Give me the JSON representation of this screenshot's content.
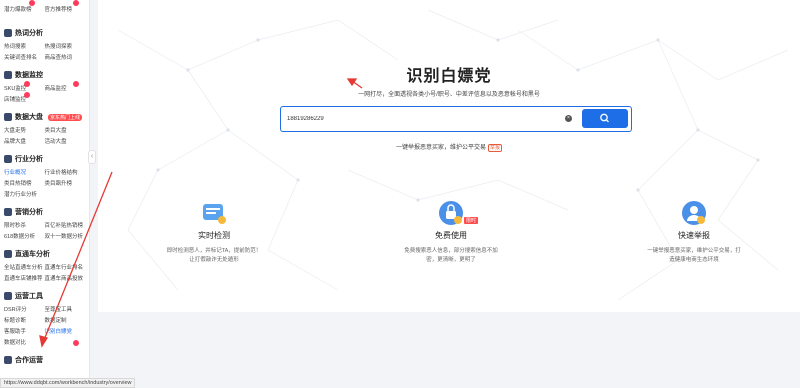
{
  "sidebar": {
    "top_row": [
      "潜力爆款榜",
      "官方推荐榜"
    ],
    "sections": [
      {
        "title": "热词分析",
        "tag": "",
        "items": [
          "热词搜索",
          "热搜词探索",
          "关键词查排名",
          "商品查热词"
        ]
      },
      {
        "title": "数据监控",
        "tag": "",
        "items": [
          "SKU监控",
          "商品监控",
          "店铺监控"
        ]
      },
      {
        "title": "数据大盘",
        "tag": "京东热门上线",
        "items": [
          "大盘走势",
          "类目大盘",
          "品牌大盘",
          "活动大盘"
        ]
      },
      {
        "title": "行业分析",
        "tag": "",
        "items": [
          "行业概况",
          "行业价格结构",
          "类目热销榜",
          "类目飙升榜",
          "潜力行业分析"
        ]
      },
      {
        "title": "营销分析",
        "tag": "",
        "items": [
          "限时秒杀",
          "百亿补贴热销榜",
          "618数据分析",
          "双十一数据分析"
        ]
      },
      {
        "title": "直通车分析",
        "tag": "",
        "items": [
          "全站直通车分析",
          "直通车行业排名",
          "直通车店铺推荐",
          "直通车商品投放"
        ]
      },
      {
        "title": "运营工具",
        "tag": "",
        "items": [
          "DSR评分",
          "至尊宝工具",
          "标题诊断",
          "数据定制",
          "客服助手",
          "识别白嫖党",
          "数据对比"
        ]
      },
      {
        "title": "合作运营",
        "tag": "",
        "items": []
      }
    ]
  },
  "main": {
    "title": "识别白嫖党",
    "subtitle": "一网打尽，全面透视各类小号/职号、中差评信息以及恶意帐号和黑号",
    "search_value": "18819286229",
    "hint": "一键举报恶意买家，维护公平交易",
    "hint_link": "举报",
    "features": [
      {
        "title": "实时检测",
        "desc_1": "即时检测恶人，并标记TA，提前防范！",
        "desc_2": "让打假敲诈无处遁形"
      },
      {
        "title": "免费使用",
        "desc_1": "免费搜索恶人信息，部分搜索信息不加",
        "desc_2": "密，更清晰，更明了",
        "badge": "限时"
      },
      {
        "title": "快速举报",
        "desc_1": "一键举报恶意买家，维护公平交易，打",
        "desc_2": "造健康电商生态环境"
      }
    ]
  },
  "statusbar": {
    "url": "https://www.ddqbt.com/workbench/industry/overview"
  },
  "colors": {
    "accent": "#1e6ee8",
    "annotation": "#e53935",
    "badge": "#ff3b5c"
  }
}
